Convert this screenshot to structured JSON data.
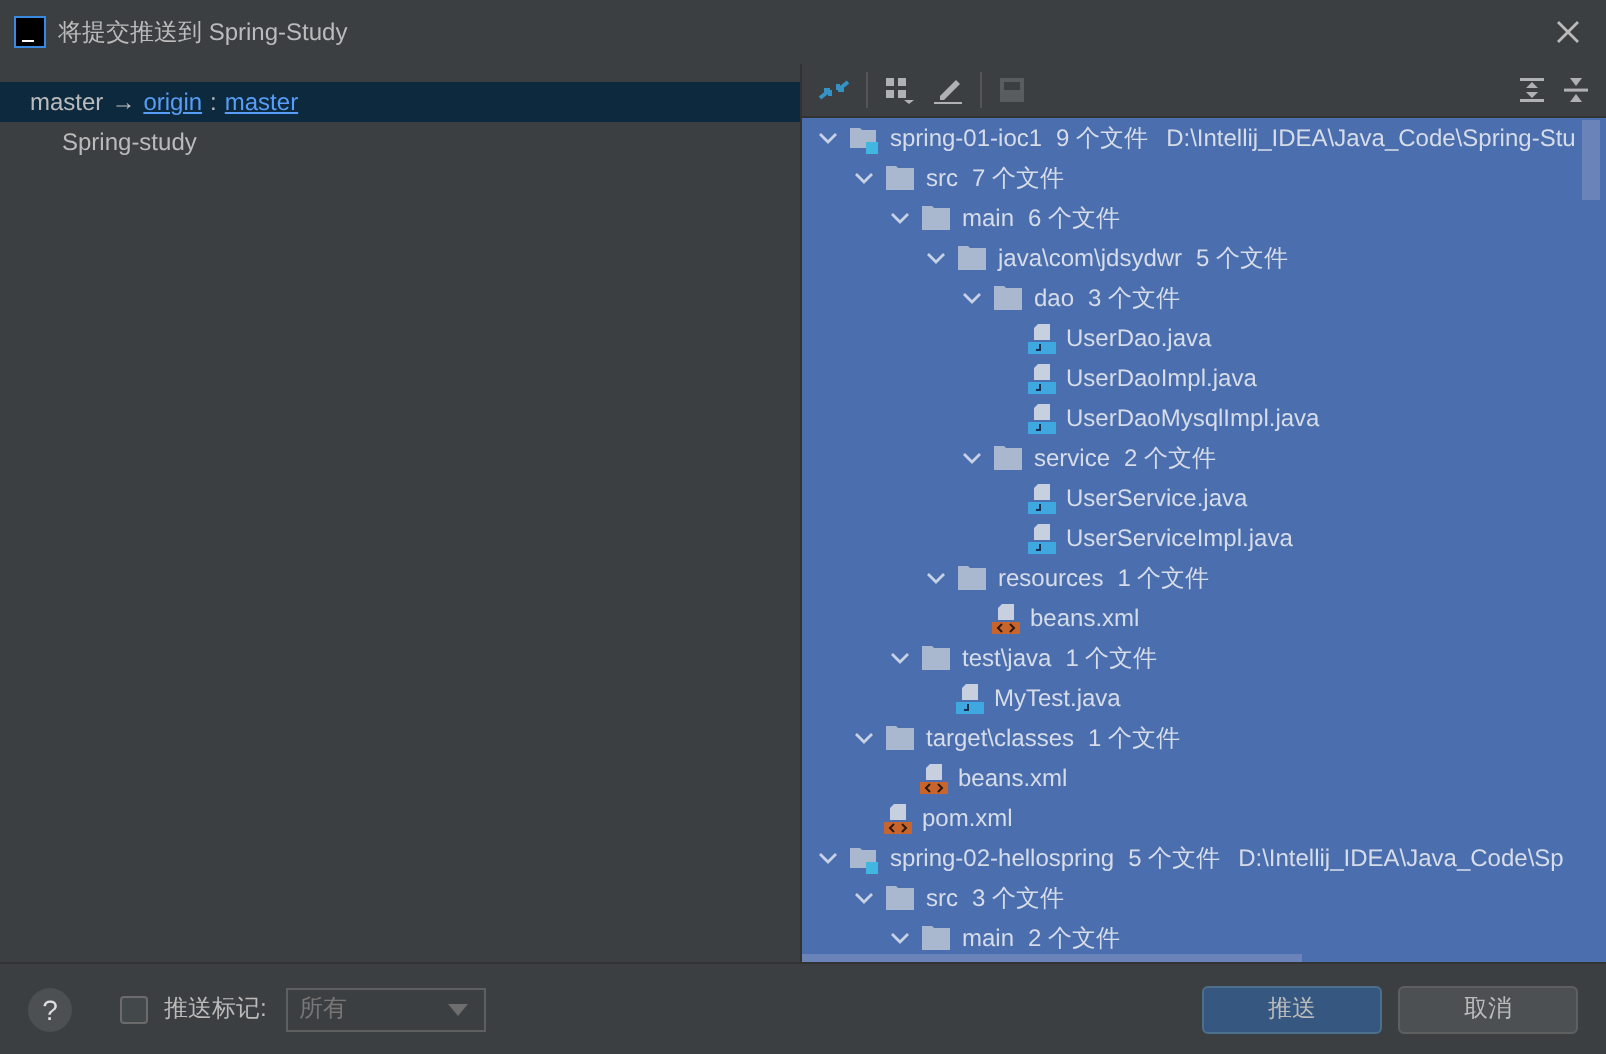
{
  "window": {
    "title": "将提交推送到 Spring-Study"
  },
  "branches": [
    {
      "source": "master",
      "arrow": "→",
      "remote": "origin",
      "separator": ":",
      "target": "master",
      "selected": true
    },
    {
      "name": "Spring-study",
      "selected": false
    }
  ],
  "tree": [
    {
      "kind": "module",
      "name": "spring-01-ioc1",
      "count": "9 个文件",
      "path": "D:\\Intellij_IDEA\\Java_Code\\Spring-Stu",
      "expanded": true,
      "children": [
        {
          "kind": "folder",
          "name": "src",
          "count": "7 个文件",
          "expanded": true,
          "children": [
            {
              "kind": "folder",
              "name": "main",
              "count": "6 个文件",
              "expanded": true,
              "children": [
                {
                  "kind": "folder",
                  "name": "java\\com\\jdsydwr",
                  "count": "5 个文件",
                  "expanded": true,
                  "children": [
                    {
                      "kind": "folder",
                      "name": "dao",
                      "count": "3 个文件",
                      "expanded": true,
                      "children": [
                        {
                          "kind": "java",
                          "name": "UserDao.java"
                        },
                        {
                          "kind": "java",
                          "name": "UserDaoImpl.java"
                        },
                        {
                          "kind": "java",
                          "name": "UserDaoMysqlImpl.java"
                        }
                      ]
                    },
                    {
                      "kind": "folder",
                      "name": "service",
                      "count": "2 个文件",
                      "expanded": true,
                      "children": [
                        {
                          "kind": "java",
                          "name": "UserService.java"
                        },
                        {
                          "kind": "java",
                          "name": "UserServiceImpl.java"
                        }
                      ]
                    }
                  ]
                },
                {
                  "kind": "folder",
                  "name": "resources",
                  "count": "1 个文件",
                  "expanded": true,
                  "children": [
                    {
                      "kind": "xml",
                      "name": "beans.xml"
                    }
                  ]
                }
              ]
            },
            {
              "kind": "folder",
              "name": "test\\java",
              "count": "1 个文件",
              "expanded": true,
              "children": [
                {
                  "kind": "java",
                  "name": "MyTest.java"
                }
              ]
            }
          ]
        },
        {
          "kind": "folder",
          "name": "target\\classes",
          "count": "1 个文件",
          "expanded": true,
          "children": [
            {
              "kind": "xml",
              "name": "beans.xml"
            }
          ]
        },
        {
          "kind": "xml",
          "name": "pom.xml"
        }
      ]
    },
    {
      "kind": "module",
      "name": "spring-02-hellospring",
      "count": "5 个文件",
      "path": "D:\\Intellij_IDEA\\Java_Code\\Sp",
      "expanded": true,
      "children": [
        {
          "kind": "folder",
          "name": "src",
          "count": "3 个文件",
          "expanded": true,
          "children": [
            {
              "kind": "folder",
              "name": "main",
              "count": "2 个文件",
              "expanded": true
            }
          ]
        }
      ]
    }
  ],
  "footer": {
    "help": "?",
    "push_tags": {
      "label": "推送标记:",
      "checked": false
    },
    "tag_select": {
      "value": "所有"
    },
    "buttons": [
      {
        "label": "推送",
        "kind": "primary"
      },
      {
        "label": "取消",
        "kind": "secondary"
      }
    ]
  }
}
